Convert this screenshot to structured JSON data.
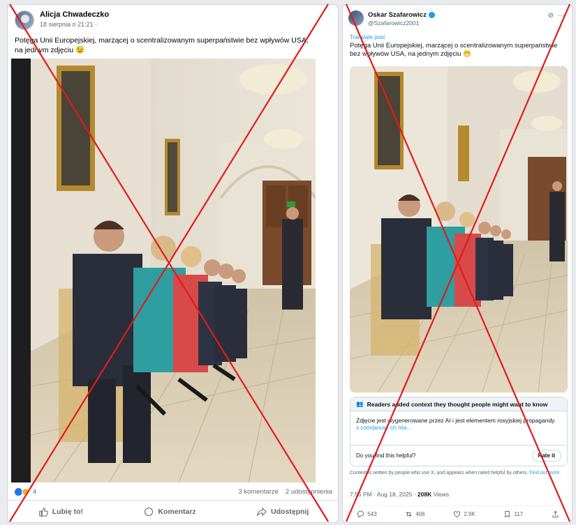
{
  "facebook_post": {
    "author": "Alicja Chwadeczko",
    "date": "18 sierpnia o 21:21 ·",
    "text": "Potęga Unii Europejskiej, marzącej o scentralizowanym superpaństwie bez wpływów USA, na jednym zdjęciu 😉",
    "reactions_count": "4",
    "comments": "3 komentarze",
    "shares": "2 udostępnienia",
    "actions": {
      "like": "Lubię to!",
      "comment": "Komentarz",
      "share": "Udostępnij"
    }
  },
  "x_post": {
    "author": "Oskar Szafarowicz",
    "handle": "@Szafarowicz2001",
    "translate": "Translate post",
    "text": "Potęga Unii Europejskiej, marzącej o scentralizowanym superpaństwie bez wpływów USA, na jednym zdjęciu 😬",
    "community_note": {
      "heading": "Readers added context they thought people might want to know",
      "body": "Zdjęcie jest wygenerowane przez AI i jest elementem rosyjskiej propagandy.",
      "link": "x.com/janusz ch /sta...",
      "question": "Do you find this helpful?",
      "rate_button": "Rate it"
    },
    "disclaimer": "Context is written by people who use X, and appears when rated helpful by others.",
    "disclaimer_link": "Find out more.",
    "timestamp": "7:55 PM · Aug 18, 2025 ·",
    "views_count": "208K",
    "views_label": "Views",
    "stats": {
      "replies": "543",
      "reposts": "406",
      "likes": "2.9K",
      "bookmarks": "117"
    }
  },
  "colors": {
    "fb_blue": "#1877f2",
    "x_blue": "#1d9bf0",
    "cross_red": "#e01b1b"
  }
}
